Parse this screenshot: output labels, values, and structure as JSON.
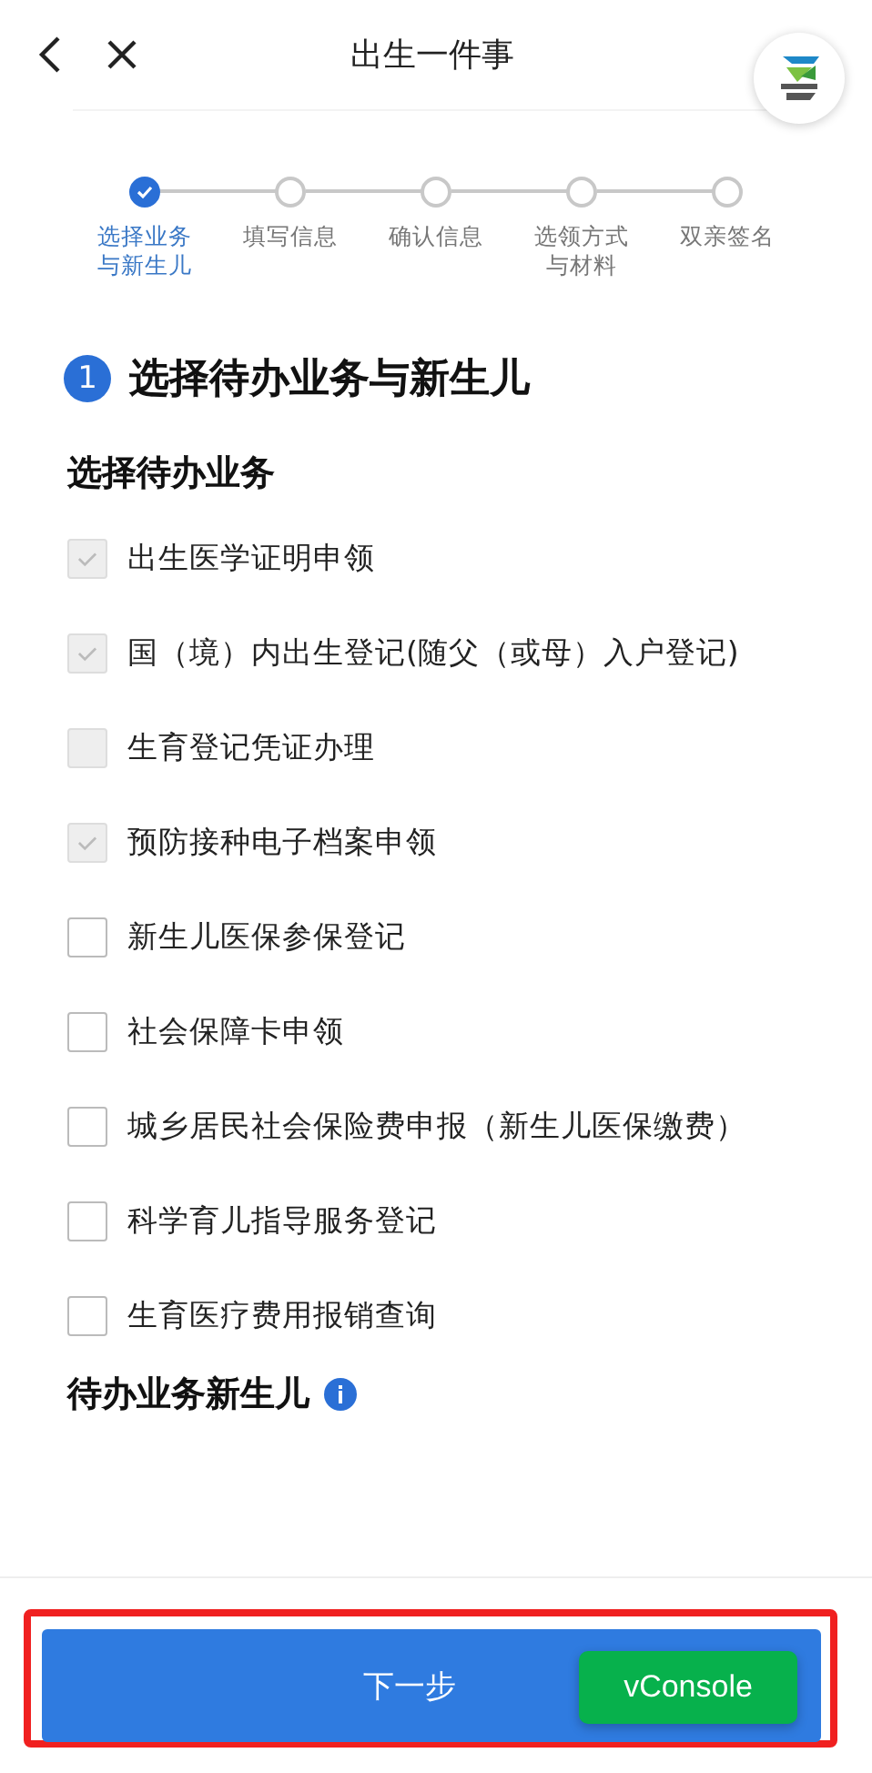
{
  "header": {
    "title": "出生一件事"
  },
  "steps": [
    {
      "label": "选择业务与新生儿",
      "done": true
    },
    {
      "label": "填写信息",
      "done": false
    },
    {
      "label": "确认信息",
      "done": false
    },
    {
      "label": "选领方式与材料",
      "done": false
    },
    {
      "label": "双亲签名",
      "done": false
    }
  ],
  "section": {
    "number": "1",
    "title": "选择待办业务与新生儿"
  },
  "subheading": "选择待办业务",
  "options": [
    {
      "label": "出生医学证明申领",
      "checked": true,
      "disabled": true
    },
    {
      "label": "国（境）内出生登记(随父（或母）入户登记)",
      "checked": true,
      "disabled": true
    },
    {
      "label": "生育登记凭证办理",
      "checked": false,
      "disabled": true
    },
    {
      "label": "预防接种电子档案申领",
      "checked": true,
      "disabled": true
    },
    {
      "label": "新生儿医保参保登记",
      "checked": false,
      "disabled": false
    },
    {
      "label": "社会保障卡申领",
      "checked": false,
      "disabled": false
    },
    {
      "label": "城乡居民社会保险费申报（新生儿医保缴费）",
      "checked": false,
      "disabled": false
    },
    {
      "label": "科学育儿指导服务登记",
      "checked": false,
      "disabled": false
    },
    {
      "label": "生育医疗费用报销查询",
      "checked": false,
      "disabled": false
    }
  ],
  "next_heading": "待办业务新生儿",
  "footer": {
    "highlighted": true,
    "button": "下一步",
    "console_button": "vConsole"
  }
}
